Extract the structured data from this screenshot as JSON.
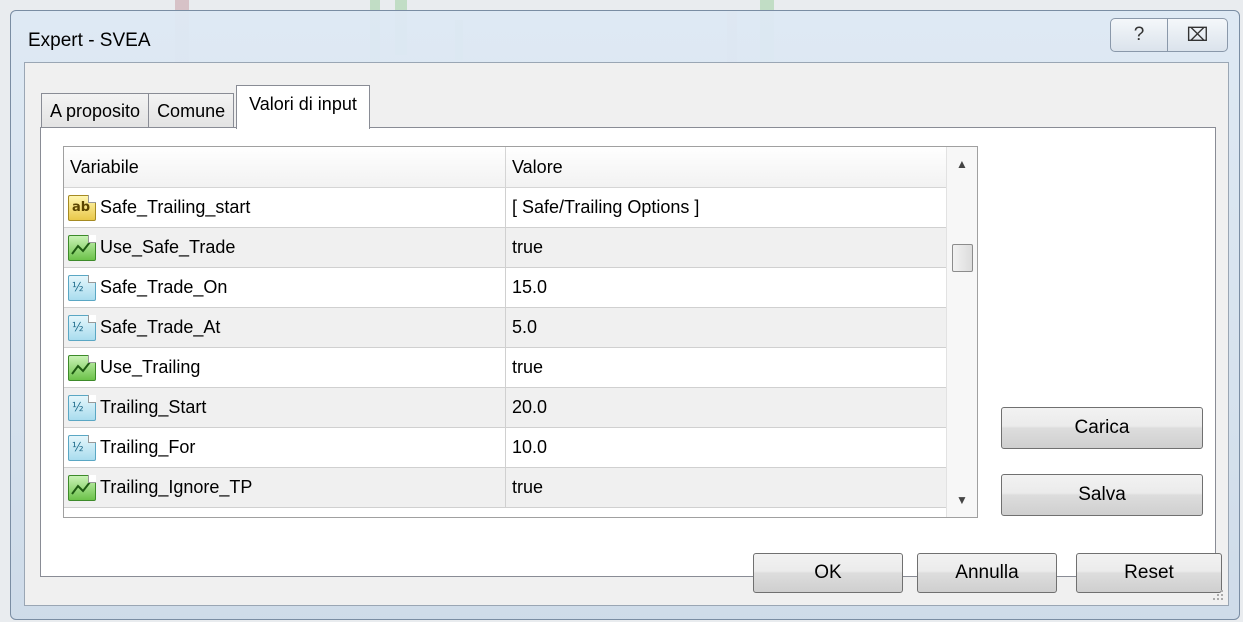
{
  "window": {
    "title": "Expert - SVEA",
    "help_glyph": "?",
    "close_glyph": "⌧"
  },
  "tabs": [
    {
      "label": "A proposito",
      "active": false
    },
    {
      "label": "Comune",
      "active": false
    },
    {
      "label": "Valori di input",
      "active": true
    }
  ],
  "grid": {
    "headers": {
      "variable": "Variabile",
      "value": "Valore"
    },
    "rows": [
      {
        "icon": "ab-string-icon",
        "name": "Safe_Trailing_start",
        "value": "[ Safe/Trailing Options ]"
      },
      {
        "icon": "bool-icon",
        "name": "Use_Safe_Trade",
        "value": "true"
      },
      {
        "icon": "double-icon",
        "name": "Safe_Trade_On",
        "value": "15.0"
      },
      {
        "icon": "double-icon",
        "name": "Safe_Trade_At",
        "value": "5.0"
      },
      {
        "icon": "bool-icon",
        "name": "Use_Trailing",
        "value": "true"
      },
      {
        "icon": "double-icon",
        "name": "Trailing_Start",
        "value": "20.0"
      },
      {
        "icon": "double-icon",
        "name": "Trailing_For",
        "value": "10.0"
      },
      {
        "icon": "bool-icon",
        "name": "Trailing_Ignore_TP",
        "value": "true"
      }
    ],
    "scroll_up_glyph": "▲",
    "scroll_down_glyph": "▼",
    "icon_text": {
      "ab": "ab",
      "num": "½"
    }
  },
  "side_buttons": {
    "load": "Carica",
    "save": "Salva"
  },
  "footer_buttons": {
    "ok": "OK",
    "cancel": "Annulla",
    "reset": "Reset"
  }
}
